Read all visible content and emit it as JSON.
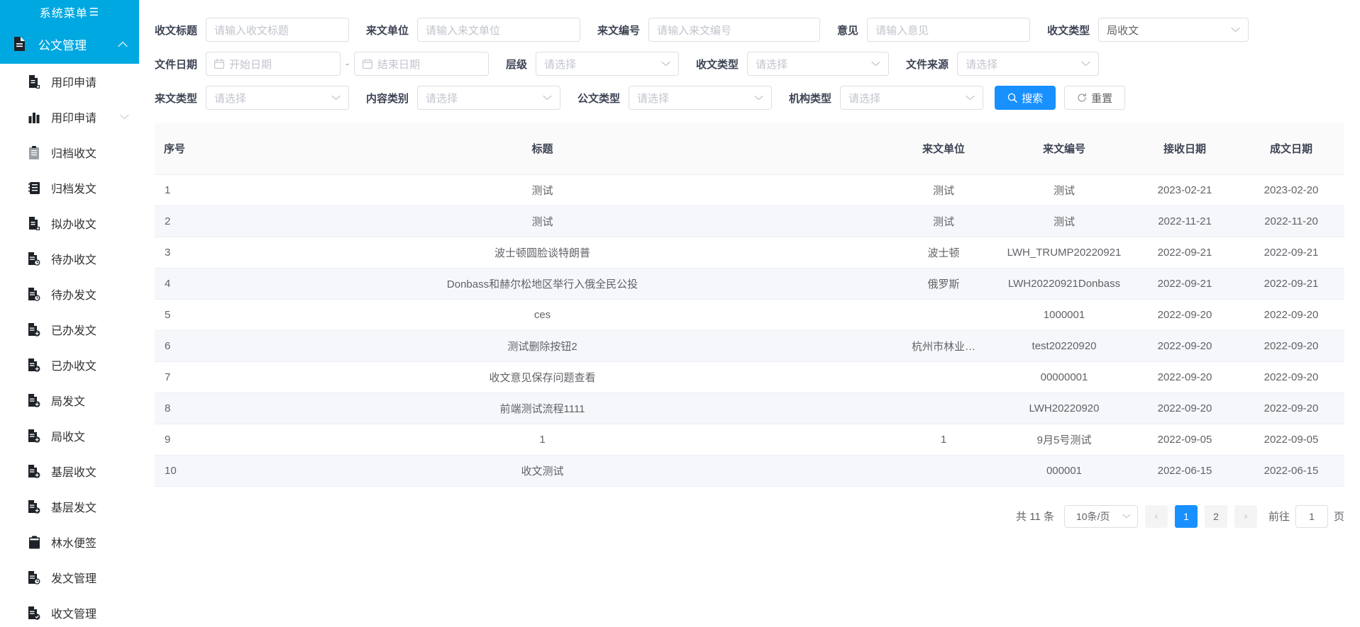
{
  "sidebar": {
    "title": "系统菜单",
    "collapse_glyph": "☰",
    "group": {
      "label": "公文管理",
      "icon": "document-icon",
      "chevron": "⌃"
    },
    "items": [
      {
        "label": "用印申请",
        "icon": "stamp-apply-icon",
        "chevron": ""
      },
      {
        "label": "用印申请",
        "icon": "chart-bar-icon",
        "chevron": "⌄"
      },
      {
        "label": "归档收文",
        "icon": "archive-receive-icon",
        "chevron": ""
      },
      {
        "label": "归档发文",
        "icon": "archive-send-icon",
        "chevron": ""
      },
      {
        "label": "拟办收文",
        "icon": "draft-receive-icon",
        "chevron": ""
      },
      {
        "label": "待办收文",
        "icon": "todo-receive-icon",
        "chevron": ""
      },
      {
        "label": "待办发文",
        "icon": "todo-send-icon",
        "chevron": ""
      },
      {
        "label": "已办发文",
        "icon": "done-send-icon",
        "chevron": ""
      },
      {
        "label": "已办收文",
        "icon": "done-receive-icon",
        "chevron": ""
      },
      {
        "label": "局发文",
        "icon": "bureau-send-icon",
        "chevron": ""
      },
      {
        "label": "局收文",
        "icon": "bureau-receive-icon",
        "chevron": ""
      },
      {
        "label": "基层收文",
        "icon": "grassroots-receive-icon",
        "chevron": ""
      },
      {
        "label": "基层发文",
        "icon": "grassroots-send-icon",
        "chevron": ""
      },
      {
        "label": "林水便签",
        "icon": "notes-icon",
        "chevron": ""
      },
      {
        "label": "发文管理",
        "icon": "send-manage-icon",
        "chevron": ""
      },
      {
        "label": "收文管理",
        "icon": "receive-manage-icon",
        "chevron": ""
      }
    ]
  },
  "filters": {
    "row1": [
      {
        "label": "收文标题",
        "placeholder": "请输入收文标题",
        "value": "",
        "type": "input"
      },
      {
        "label": "来文单位",
        "placeholder": "请输入来文单位",
        "value": "",
        "type": "input"
      },
      {
        "label": "来文编号",
        "placeholder": "请输入来文编号",
        "value": "",
        "type": "input"
      },
      {
        "label": "意见",
        "placeholder": "请输入意见",
        "value": "",
        "type": "input"
      },
      {
        "label": "收文类型",
        "placeholder": "请选择",
        "value": "局收文",
        "type": "select"
      }
    ],
    "row2_date": {
      "label": "文件日期",
      "start_placeholder": "开始日期",
      "end_placeholder": "结束日期",
      "separator": "-"
    },
    "row2": [
      {
        "label": "层级",
        "placeholder": "请选择",
        "value": "",
        "type": "select"
      },
      {
        "label": "收文类型",
        "placeholder": "请选择",
        "value": "",
        "type": "select"
      },
      {
        "label": "文件来源",
        "placeholder": "请选择",
        "value": "",
        "type": "select"
      }
    ],
    "row3": [
      {
        "label": "来文类型",
        "placeholder": "请选择",
        "value": "",
        "type": "select"
      },
      {
        "label": "内容类别",
        "placeholder": "请选择",
        "value": "",
        "type": "select"
      },
      {
        "label": "公文类型",
        "placeholder": "请选择",
        "value": "",
        "type": "select"
      },
      {
        "label": "机构类型",
        "placeholder": "请选择",
        "value": "",
        "type": "select"
      }
    ],
    "search_button": "搜索",
    "reset_button": "重置",
    "search_icon": "search-icon",
    "reset_icon": "refresh-icon"
  },
  "table": {
    "headers": [
      "序号",
      "标题",
      "来文单位",
      "来文编号",
      "接收日期",
      "成文日期"
    ],
    "rows": [
      {
        "index": "1",
        "title": "测试",
        "unit": "测试",
        "number": "测试",
        "received": "2023-02-21",
        "completed": "2023-02-20"
      },
      {
        "index": "2",
        "title": "测试",
        "unit": "测试",
        "number": "测试",
        "received": "2022-11-21",
        "completed": "2022-11-20"
      },
      {
        "index": "3",
        "title": "波士顿圆脸谈特朗普",
        "unit": "波士顿",
        "number": "LWH_TRUMP20220921",
        "received": "2022-09-21",
        "completed": "2022-09-21"
      },
      {
        "index": "4",
        "title": "Donbass和赫尔松地区举行入俄全民公投",
        "unit": "俄罗斯",
        "number": "LWH20220921Donbass",
        "received": "2022-09-21",
        "completed": "2022-09-21"
      },
      {
        "index": "5",
        "title": "ces",
        "unit": "",
        "number": "1000001",
        "received": "2022-09-20",
        "completed": "2022-09-20"
      },
      {
        "index": "6",
        "title": "测试删除按钮2",
        "unit": "杭州市林业…",
        "number": "test20220920",
        "received": "2022-09-20",
        "completed": "2022-09-20"
      },
      {
        "index": "7",
        "title": "收文意见保存问题查看",
        "unit": "",
        "number": "00000001",
        "received": "2022-09-20",
        "completed": "2022-09-20"
      },
      {
        "index": "8",
        "title": "前端测试流程1111",
        "unit": "",
        "number": "LWH20220920",
        "received": "2022-09-20",
        "completed": "2022-09-20"
      },
      {
        "index": "9",
        "title": "1",
        "unit": "1",
        "number": "9月5号测试",
        "received": "2022-09-05",
        "completed": "2022-09-05"
      },
      {
        "index": "10",
        "title": "收文测试",
        "unit": "",
        "number": "000001",
        "received": "2022-06-15",
        "completed": "2022-06-15"
      }
    ]
  },
  "pagination": {
    "total_text": "共 11 条",
    "page_size": "10条/页",
    "prev": "‹",
    "next": "›",
    "pages": [
      "1",
      "2"
    ],
    "current_page": "1",
    "jump_prefix": "前往",
    "jump_value": "1",
    "jump_suffix": "页"
  },
  "colors": {
    "sidebar_blue": "#00a8e1",
    "primary_blue": "#1890ff",
    "stripe": "#f5f7fa",
    "header_bg": "#fafafa"
  }
}
